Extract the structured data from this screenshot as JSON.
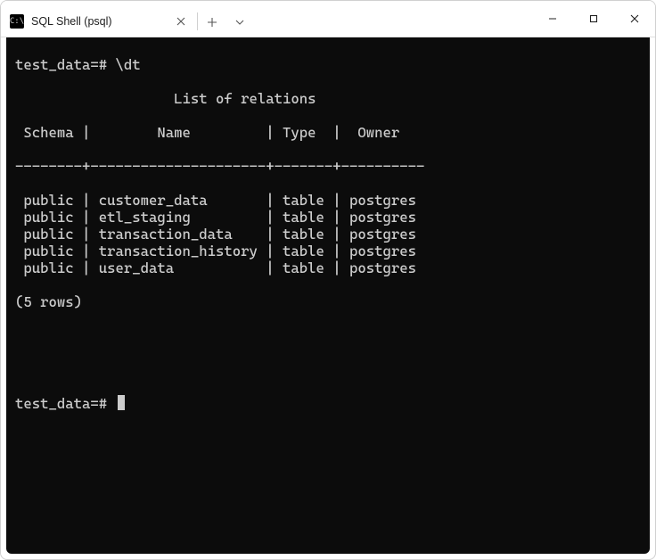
{
  "window": {
    "tab_title": "SQL Shell (psql)"
  },
  "terminal": {
    "prompt_db": "test_data",
    "prompt_suffix": "=#",
    "command": "\\dt",
    "list_heading": "List of relations",
    "columns": {
      "schema": "Schema",
      "name": "Name",
      "type": "Type",
      "owner": "Owner"
    },
    "rows": [
      {
        "schema": "public",
        "name": "customer_data",
        "type": "table",
        "owner": "postgres"
      },
      {
        "schema": "public",
        "name": "etl_staging",
        "type": "table",
        "owner": "postgres"
      },
      {
        "schema": "public",
        "name": "transaction_data",
        "type": "table",
        "owner": "postgres"
      },
      {
        "schema": "public",
        "name": "transaction_history",
        "type": "table",
        "owner": "postgres"
      },
      {
        "schema": "public",
        "name": "user_data",
        "type": "table",
        "owner": "postgres"
      }
    ],
    "row_count_text": "(5 rows)"
  }
}
